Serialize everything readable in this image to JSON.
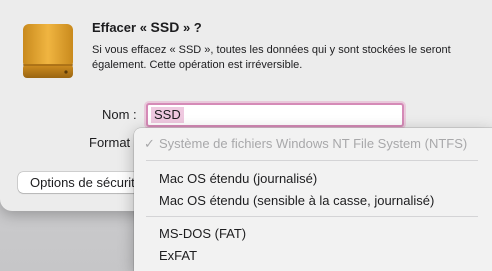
{
  "dialog": {
    "title_prefix": "Effacer « ",
    "title_name": "SSD",
    "title_suffix": " » ?",
    "message": "Si vous effacez « SSD », toutes les données qui y sont stockées le seront également. Cette opération est irréversible.",
    "icon": "external-drive-icon"
  },
  "form": {
    "name_label": "Nom :",
    "name_value": "SSD",
    "format_label": "Format"
  },
  "buttons": {
    "security_options_label": "Options de sécurité…"
  },
  "format_menu": {
    "items": [
      {
        "label": "Système de fichiers Windows NT File System (NTFS)",
        "state": "selected, disabled"
      },
      {
        "label": "Mac OS étendu (journalisé)"
      },
      {
        "label": "Mac OS étendu (sensible à la casse, journalisé)"
      },
      {
        "label": "MS-DOS (FAT)"
      },
      {
        "label": "ExFAT"
      }
    ],
    "check_mark": "✓"
  }
}
